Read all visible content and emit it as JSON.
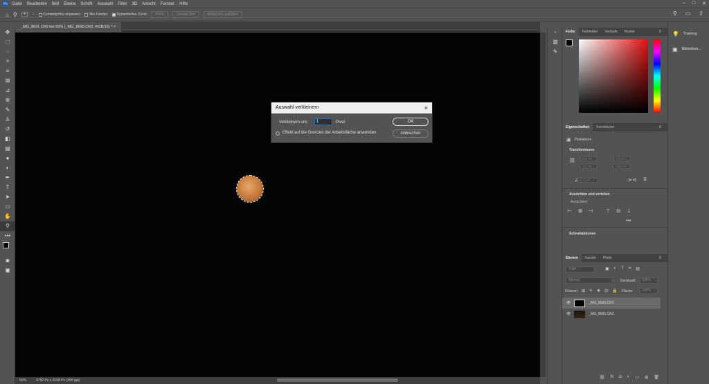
{
  "app_logo": "Ps",
  "menu": [
    "Datei",
    "Bearbeiten",
    "Bild",
    "Ebene",
    "Schrift",
    "Auswahl",
    "Filter",
    "3D",
    "Ansicht",
    "Fenster",
    "Hilfe"
  ],
  "options_bar": {
    "fit_window": "Fenstergröße anpassen",
    "all_windows": "Alle Fenster",
    "dynamic_zoom": "Dynamischer Zoom",
    "zoom_value": "100%",
    "whole_image": "Ganzes Bild",
    "fill_screen": "Bildschirm ausfüllen"
  },
  "document_tab": "_MG_8691.CR2 bei 50% (_MG_8690.CR2, RGB/16) *",
  "status": {
    "zoom": "50%",
    "doc_size": "4752 Px x 3168 Px (300 ppi)"
  },
  "dialog": {
    "title": "Auswahl verkleinern",
    "shrink_label": "Verkleinern um:",
    "shrink_value": "1",
    "unit": "Pixel",
    "apply_edges_label": "Effekt auf die Grenzen der Arbeitsfläche anwenden",
    "ok_label": "OK",
    "cancel_label": "Abbrechen"
  },
  "color_panel": {
    "tabs": [
      "Farbe",
      "Farbfelder",
      "Verläufe",
      "Muster"
    ]
  },
  "properties_panel": {
    "tabs": [
      "Eigenschaften",
      "Korrekturen"
    ],
    "layer_type": "Pixelebene",
    "transform_title": "Transformieren",
    "w_value": "224 Px",
    "x_value": "2376 Px",
    "h_value": "157 Px",
    "y_value": "1584 Px",
    "angle_value": "0,00°",
    "align_title": "Ausrichten und verteilen",
    "align_sub": "Ausrichten:",
    "quick_actions_title": "Schnellaktionen"
  },
  "layers_panel": {
    "tabs": [
      "Ebenen",
      "Kanäle",
      "Pfade"
    ],
    "search_placeholder": "Art",
    "blend_mode": "Normal",
    "opacity_label": "Deckkraft:",
    "opacity_value": "100%",
    "lock_label": "Fixieren:",
    "fill_label": "Fläche:",
    "fill_value": "100%",
    "layers": [
      {
        "name": "_MG_8690.CR2",
        "selected": true
      },
      {
        "name": "_MG_8691.CR2",
        "selected": false
      }
    ]
  },
  "far_right": {
    "items": [
      "Training",
      "Bibliothek..."
    ]
  }
}
